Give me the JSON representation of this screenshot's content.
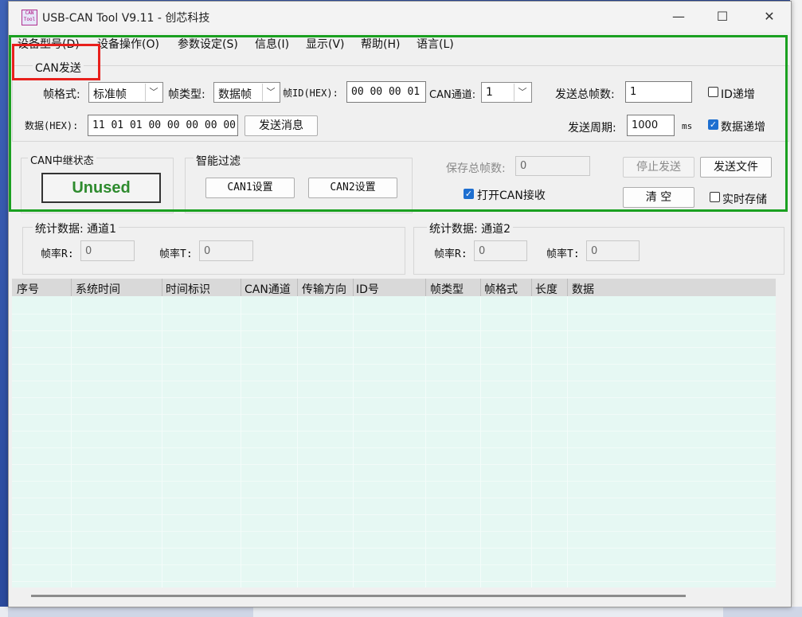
{
  "window": {
    "title": "USB-CAN Tool V9.11 - 创芯科技",
    "icon_text": "CAN Tool",
    "minimize": "—",
    "maximize": "☐",
    "close": "✕"
  },
  "menu": [
    "设备型号(D)",
    "设备操作(O)",
    "参数设定(S)",
    "信息(I)",
    "显示(V)",
    "帮助(H)",
    "语言(L)"
  ],
  "can_send": {
    "group_title": "CAN发送",
    "frame_format_label": "帧格式:",
    "frame_format_value": "标准帧",
    "frame_type_label": "帧类型:",
    "frame_type_value": "数据帧",
    "frame_id_label": "帧ID(HEX):",
    "frame_id_value": "00 00 00 01",
    "can_channel_label": "CAN通道:",
    "can_channel_value": "1",
    "total_frames_label": "发送总帧数:",
    "total_frames_value": "1",
    "id_increment_label": "ID递增",
    "id_increment_checked": false,
    "data_label": "数据(HEX):",
    "data_value": "11 01 01 00 00 00 00 00",
    "send_button": "发送消息",
    "period_label": "发送周期:",
    "period_value": "1000",
    "period_unit": "ms",
    "data_increment_label": "数据递增",
    "data_increment_checked": true
  },
  "relay": {
    "title": "CAN中继状态",
    "status": "Unused",
    "status_color": "#2e8b2e"
  },
  "filter": {
    "title": "智能过滤",
    "can1_button": "CAN1设置",
    "can2_button": "CAN2设置"
  },
  "save": {
    "total_label": "保存总帧数:",
    "total_value": "0",
    "stop_button": "停止发送",
    "send_file_button": "发送文件",
    "open_can_label": "打开CAN接收",
    "open_can_checked": true,
    "clear_button": "清 空",
    "realtime_label": "实时存储",
    "realtime_checked": false
  },
  "stats": [
    {
      "title": "统计数据: 通道1",
      "rx_label": "帧率R:",
      "rx_value": "0",
      "tx_label": "帧率T:",
      "tx_value": "0"
    },
    {
      "title": "统计数据: 通道2",
      "rx_label": "帧率R:",
      "rx_value": "0",
      "tx_label": "帧率T:",
      "tx_value": "0"
    }
  ],
  "table": {
    "columns": [
      "序号",
      "系统时间",
      "时间标识",
      "CAN通道",
      "传输方向",
      "ID号",
      "帧类型",
      "帧格式",
      "长度",
      "数据"
    ]
  },
  "colors": {
    "highlight_green": "#1aa020",
    "highlight_red": "#e8201c",
    "table_bg": "#e6f8f3"
  }
}
